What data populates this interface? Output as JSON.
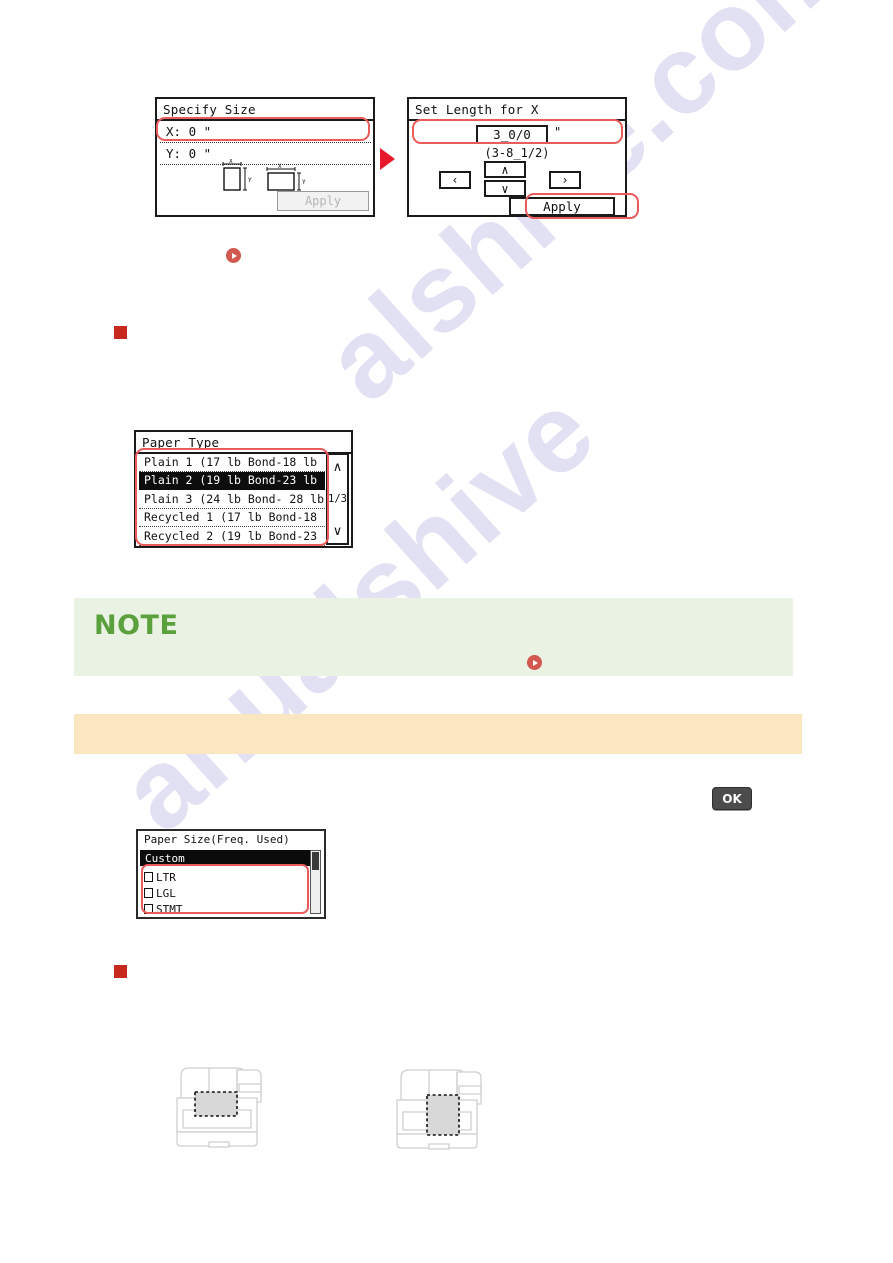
{
  "watermark": {
    "line1": "alshive.com",
    "line2": "anualshive"
  },
  "screen_specify_size": {
    "title": "Specify Size",
    "row_x": "X: 0 \"",
    "row_y": "Y: 0 \"",
    "apply_label": "Apply",
    "diagram_labels": {
      "x": "X",
      "y": "Y"
    }
  },
  "flow": {
    "arrow_icon": "right-triangle-arrow"
  },
  "screen_set_length": {
    "title": "Set Length for X",
    "value": "3_0/0",
    "unit": "\"",
    "range": "(3-8_1/2)",
    "key_left": "‹",
    "key_right": "›",
    "key_up": "∧",
    "key_down": "∨",
    "apply_label": "Apply"
  },
  "screen_paper_type": {
    "title": "Paper Type",
    "items": [
      {
        "label": "Plain 1 (17 lb Bond-18 lb",
        "selected": false
      },
      {
        "label": "Plain 2 (19 lb Bond-23 lb",
        "selected": true
      },
      {
        "label": "Plain 3 (24 lb Bond- 28 lb",
        "selected": false
      },
      {
        "label": "Recycled 1 (17 lb Bond-18",
        "selected": false
      },
      {
        "label": "Recycled 2 (19 lb Bond-23",
        "selected": false
      }
    ],
    "scroll_up": "∧",
    "scroll_down": "∨",
    "page_indicator": "1/3"
  },
  "screen_paper_size": {
    "title": "Paper Size(Freq. Used)",
    "highlighted_item": "Custom",
    "items": [
      {
        "label": "LTR",
        "checked": false
      },
      {
        "label": "LGL",
        "checked": false
      },
      {
        "label": "STMT",
        "checked": false
      }
    ]
  },
  "note_callout": {
    "label": "NOTE",
    "body": ""
  },
  "orange_band": {
    "text": ""
  },
  "ok_key": {
    "label": "OK"
  },
  "colors": {
    "highlight_red": "#ec5b5b",
    "bullet_red": "#c8291e",
    "arrow_red": "#e8192c",
    "note_green": "#5aa03c",
    "note_bg": "#eaf2e4",
    "orange_bg": "#fae6c0",
    "lcd_selected_bg": "#0d0d0d"
  },
  "illustrations": [
    {
      "name": "printer-output-tray-top"
    },
    {
      "name": "printer-output-tray-extended"
    }
  ]
}
